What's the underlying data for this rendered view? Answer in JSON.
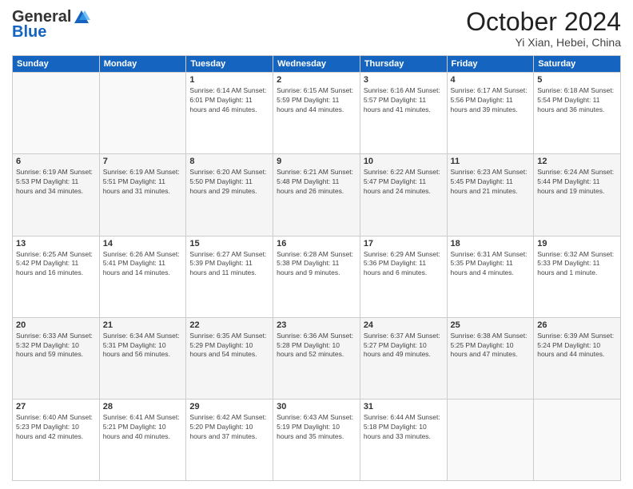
{
  "header": {
    "logo_general": "General",
    "logo_blue": "Blue",
    "month_title": "October 2024",
    "subtitle": "Yi Xian, Hebei, China"
  },
  "weekdays": [
    "Sunday",
    "Monday",
    "Tuesday",
    "Wednesday",
    "Thursday",
    "Friday",
    "Saturday"
  ],
  "weeks": [
    [
      {
        "day": "",
        "info": ""
      },
      {
        "day": "",
        "info": ""
      },
      {
        "day": "1",
        "info": "Sunrise: 6:14 AM\nSunset: 6:01 PM\nDaylight: 11 hours and 46 minutes."
      },
      {
        "day": "2",
        "info": "Sunrise: 6:15 AM\nSunset: 5:59 PM\nDaylight: 11 hours and 44 minutes."
      },
      {
        "day": "3",
        "info": "Sunrise: 6:16 AM\nSunset: 5:57 PM\nDaylight: 11 hours and 41 minutes."
      },
      {
        "day": "4",
        "info": "Sunrise: 6:17 AM\nSunset: 5:56 PM\nDaylight: 11 hours and 39 minutes."
      },
      {
        "day": "5",
        "info": "Sunrise: 6:18 AM\nSunset: 5:54 PM\nDaylight: 11 hours and 36 minutes."
      }
    ],
    [
      {
        "day": "6",
        "info": "Sunrise: 6:19 AM\nSunset: 5:53 PM\nDaylight: 11 hours and 34 minutes."
      },
      {
        "day": "7",
        "info": "Sunrise: 6:19 AM\nSunset: 5:51 PM\nDaylight: 11 hours and 31 minutes."
      },
      {
        "day": "8",
        "info": "Sunrise: 6:20 AM\nSunset: 5:50 PM\nDaylight: 11 hours and 29 minutes."
      },
      {
        "day": "9",
        "info": "Sunrise: 6:21 AM\nSunset: 5:48 PM\nDaylight: 11 hours and 26 minutes."
      },
      {
        "day": "10",
        "info": "Sunrise: 6:22 AM\nSunset: 5:47 PM\nDaylight: 11 hours and 24 minutes."
      },
      {
        "day": "11",
        "info": "Sunrise: 6:23 AM\nSunset: 5:45 PM\nDaylight: 11 hours and 21 minutes."
      },
      {
        "day": "12",
        "info": "Sunrise: 6:24 AM\nSunset: 5:44 PM\nDaylight: 11 hours and 19 minutes."
      }
    ],
    [
      {
        "day": "13",
        "info": "Sunrise: 6:25 AM\nSunset: 5:42 PM\nDaylight: 11 hours and 16 minutes."
      },
      {
        "day": "14",
        "info": "Sunrise: 6:26 AM\nSunset: 5:41 PM\nDaylight: 11 hours and 14 minutes."
      },
      {
        "day": "15",
        "info": "Sunrise: 6:27 AM\nSunset: 5:39 PM\nDaylight: 11 hours and 11 minutes."
      },
      {
        "day": "16",
        "info": "Sunrise: 6:28 AM\nSunset: 5:38 PM\nDaylight: 11 hours and 9 minutes."
      },
      {
        "day": "17",
        "info": "Sunrise: 6:29 AM\nSunset: 5:36 PM\nDaylight: 11 hours and 6 minutes."
      },
      {
        "day": "18",
        "info": "Sunrise: 6:31 AM\nSunset: 5:35 PM\nDaylight: 11 hours and 4 minutes."
      },
      {
        "day": "19",
        "info": "Sunrise: 6:32 AM\nSunset: 5:33 PM\nDaylight: 11 hours and 1 minute."
      }
    ],
    [
      {
        "day": "20",
        "info": "Sunrise: 6:33 AM\nSunset: 5:32 PM\nDaylight: 10 hours and 59 minutes."
      },
      {
        "day": "21",
        "info": "Sunrise: 6:34 AM\nSunset: 5:31 PM\nDaylight: 10 hours and 56 minutes."
      },
      {
        "day": "22",
        "info": "Sunrise: 6:35 AM\nSunset: 5:29 PM\nDaylight: 10 hours and 54 minutes."
      },
      {
        "day": "23",
        "info": "Sunrise: 6:36 AM\nSunset: 5:28 PM\nDaylight: 10 hours and 52 minutes."
      },
      {
        "day": "24",
        "info": "Sunrise: 6:37 AM\nSunset: 5:27 PM\nDaylight: 10 hours and 49 minutes."
      },
      {
        "day": "25",
        "info": "Sunrise: 6:38 AM\nSunset: 5:25 PM\nDaylight: 10 hours and 47 minutes."
      },
      {
        "day": "26",
        "info": "Sunrise: 6:39 AM\nSunset: 5:24 PM\nDaylight: 10 hours and 44 minutes."
      }
    ],
    [
      {
        "day": "27",
        "info": "Sunrise: 6:40 AM\nSunset: 5:23 PM\nDaylight: 10 hours and 42 minutes."
      },
      {
        "day": "28",
        "info": "Sunrise: 6:41 AM\nSunset: 5:21 PM\nDaylight: 10 hours and 40 minutes."
      },
      {
        "day": "29",
        "info": "Sunrise: 6:42 AM\nSunset: 5:20 PM\nDaylight: 10 hours and 37 minutes."
      },
      {
        "day": "30",
        "info": "Sunrise: 6:43 AM\nSunset: 5:19 PM\nDaylight: 10 hours and 35 minutes."
      },
      {
        "day": "31",
        "info": "Sunrise: 6:44 AM\nSunset: 5:18 PM\nDaylight: 10 hours and 33 minutes."
      },
      {
        "day": "",
        "info": ""
      },
      {
        "day": "",
        "info": ""
      }
    ]
  ]
}
